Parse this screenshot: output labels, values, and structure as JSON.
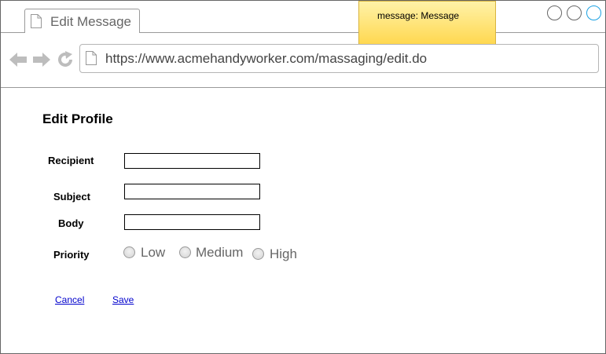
{
  "tab": {
    "title": "Edit Message"
  },
  "note": {
    "text": "message: Message"
  },
  "address_bar": {
    "url": "https://www.acmehandyworker.com/massaging/edit.do"
  },
  "form": {
    "heading": "Edit Profile",
    "recipient_label": "Recipient",
    "subject_label": "Subject",
    "body_label": "Body",
    "priority_label": "Priority",
    "recipient_value": "",
    "subject_value": "",
    "body_value": "",
    "priority_options": [
      "Low",
      "Medium",
      "High"
    ]
  },
  "actions": {
    "cancel_label": "Cancel",
    "save_label": "Save"
  },
  "colors": {
    "note": "#ffd64a",
    "link": "#0000cc",
    "accent": "#1ba1e2"
  },
  "icons": [
    "document-icon",
    "back-arrow-icon",
    "forward-arrow-icon",
    "reload-icon"
  ]
}
